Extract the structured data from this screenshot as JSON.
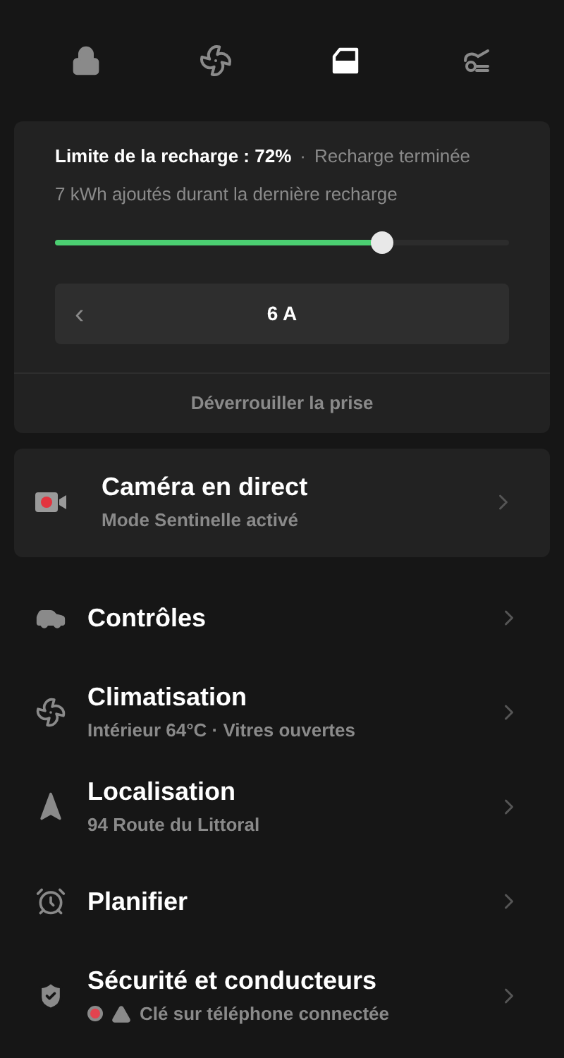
{
  "tabs": [
    {
      "selected": false
    },
    {
      "selected": false
    },
    {
      "selected": true
    },
    {
      "selected": false
    }
  ],
  "charging": {
    "limit_label": "Limite de la recharge : 72%",
    "separator": "·",
    "status": "Recharge terminée",
    "energy_added": "7 kWh ajoutés durant la dernière recharge",
    "level": 0.72,
    "current": "6 A",
    "current_prev": "‹",
    "unlock_button": "Déverrouiller la prise"
  },
  "camera": {
    "title": "Caméra en direct",
    "subtitle": "Mode Sentinelle activé"
  },
  "menu": [
    {
      "title": "Contrôles",
      "warning": false
    },
    {
      "title": "Climatisation",
      "subtitle": "Intérieur 64°C · Vitres ouvertes",
      "warning": false
    },
    {
      "title": "Localisation",
      "subtitle": "94 Route du Littoral",
      "warning": false
    },
    {
      "title": "Planifier",
      "warning": false
    },
    {
      "title": "Sécurité et conducteurs",
      "subtitle": "Clé sur téléphone connectée",
      "warning": true
    }
  ]
}
